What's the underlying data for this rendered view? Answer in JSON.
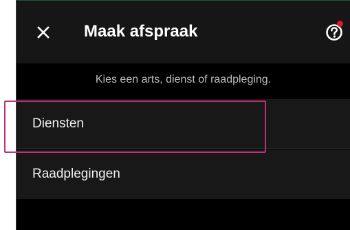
{
  "header": {
    "close_icon": "close-icon",
    "title": "Maak afspraak",
    "help_icon": "help-circle-icon",
    "notification_color": "#e0182a"
  },
  "subtitle": "Kies een arts, dienst of raadpleging.",
  "list": {
    "items": [
      {
        "label": "Diensten",
        "highlighted": true
      },
      {
        "label": "Raadplegingen",
        "highlighted": false
      }
    ]
  },
  "colors": {
    "header_bg": "#161616",
    "list_bg": "#181818",
    "page_bg": "#000000",
    "highlight": "#c0307a"
  }
}
